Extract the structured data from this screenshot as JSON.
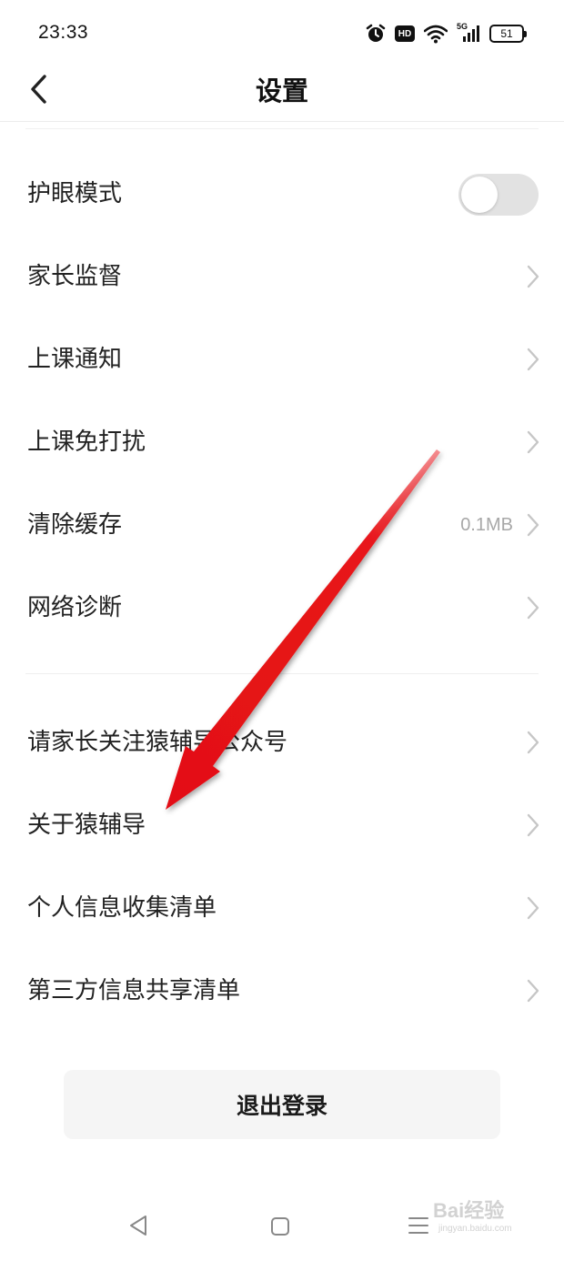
{
  "status_bar": {
    "time": "23:33",
    "hd": "HD",
    "network": "5G",
    "battery": "51",
    "icons": [
      "alarm-icon",
      "hd-icon",
      "wifi-icon",
      "signal-5g-icon",
      "battery-icon"
    ]
  },
  "header": {
    "title": "设置",
    "back_icon": "chevron-left-icon"
  },
  "settings": {
    "eye_protection": {
      "label": "护眼模式",
      "enabled": false
    },
    "group1": [
      {
        "label": "家长监督"
      },
      {
        "label": "上课通知"
      },
      {
        "label": "上课免打扰"
      },
      {
        "label": "清除缓存",
        "value": "0.1MB"
      },
      {
        "label": "网络诊断"
      }
    ],
    "group2": [
      {
        "label": "请家长关注猿辅导公众号"
      },
      {
        "label": "关于猿辅导"
      },
      {
        "label": "个人信息收集清单"
      },
      {
        "label": "第三方信息共享清单"
      }
    ]
  },
  "logout": {
    "label": "退出登录"
  },
  "nav_bar": {
    "icons": [
      "nav-back-icon",
      "nav-home-icon",
      "nav-menu-icon"
    ]
  },
  "watermark": {
    "main": "Bai经验",
    "sub": "jingyan.baidu.com"
  },
  "colors": {
    "arrow": "#e8151a",
    "toggle_off": "#e2e2e2",
    "chevron": "#c6c6c6",
    "logout_bg": "#f5f5f5"
  }
}
